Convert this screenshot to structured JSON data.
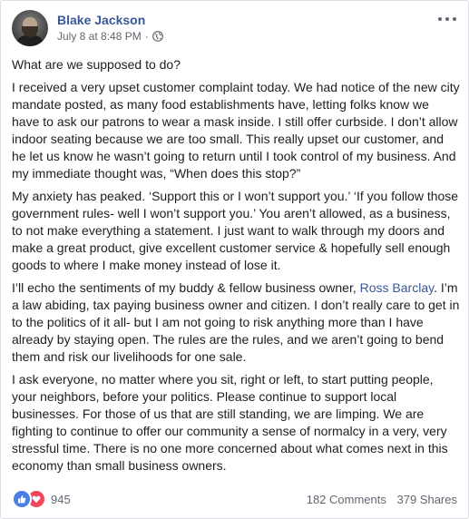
{
  "post": {
    "author": "Blake Jackson",
    "timestamp": "July 8 at 8:48 PM",
    "separator": "·",
    "privacy_icon": "globe-icon",
    "paragraphs": [
      "What are we supposed to do?",
      "I received a very upset customer complaint today. We had notice of the new city mandate posted, as many food establishments have, letting folks know we have to ask our patrons to wear a mask inside. I still offer curbside. I don’t allow indoor seating because we are too small. This really upset our customer, and he let us know he wasn’t going to return until I took control of my business. And my immediate thought was, “When does this stop?”",
      "My anxiety has peaked. ‘Support this or I won’t support you.’ ‘If you follow those government rules- well I won’t support you.’ You aren’t allowed, as a business, to not make everything a statement. I just want to walk through my doors and make a great product, give excellent customer service & hopefully sell enough goods to where I make money instead of lose it."
    ],
    "p4_before": "I’ll echo the sentiments of my buddy & fellow business owner, ",
    "p4_link": "Ross Barclay",
    "p4_after": ". I’m a law abiding, tax paying business owner and citizen. I don’t really care to get in to the politics of it all- but I am not going to risk anything more than I have already by staying open. The rules are the rules, and we aren’t going to bend them and risk our livelihoods for one sale.",
    "p5": "I ask everyone, no matter where you sit, right or left, to start putting people, your neighbors, before your politics. Please continue to support local businesses. For those of us that are still standing, we are limping. We are fighting to continue to offer our community a sense of normalcy in a very, very stressful time. There is no one more concerned about what comes next in this economy than small business owners."
  },
  "footer": {
    "reaction_count": "945",
    "comments": "182 Comments",
    "shares": "379 Shares",
    "reaction_icons": [
      "like-icon",
      "love-icon"
    ]
  },
  "colors": {
    "author": "#385898",
    "meta": "#616770",
    "like": "#4b7fe8",
    "love": "#f0485a"
  }
}
